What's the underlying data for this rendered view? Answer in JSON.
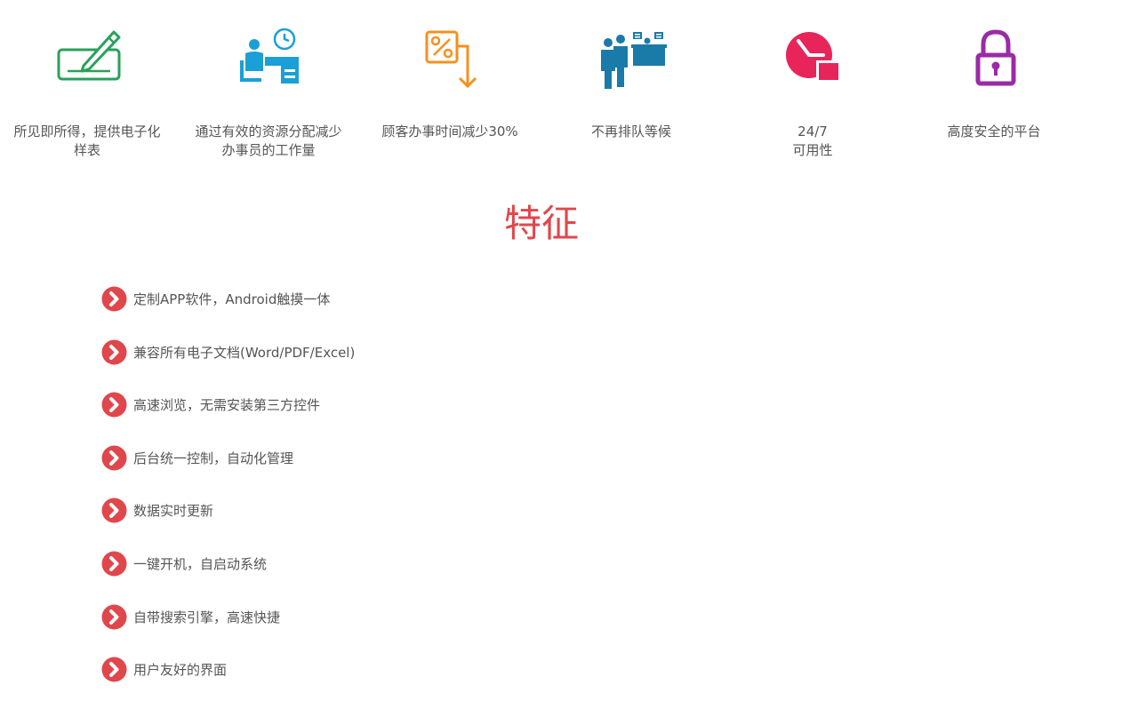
{
  "benefits": [
    {
      "icon": "form-pen-icon",
      "color": "#2aa05a",
      "caption": "所见即所得，提供电子化样表"
    },
    {
      "icon": "clerk-desk-clock-icon",
      "color": "#1a9fd6",
      "caption": "通过有效的资源分配减少办事员的工作量"
    },
    {
      "icon": "percent-arrow-down-icon",
      "color": "#f5901e",
      "caption": "顾客办事时间减少30%"
    },
    {
      "icon": "queue-people-icon",
      "color": "#1a7aa8",
      "caption": "不再排队等候"
    },
    {
      "icon": "clock-24-icon",
      "color": "#e8255a",
      "caption_line1": "24/7",
      "caption_line2": "可用性"
    },
    {
      "icon": "padlock-icon",
      "color": "#9b2aa6",
      "caption": "高度安全的平台"
    }
  ],
  "section": {
    "title": "特征",
    "accent": "#e0474c"
  },
  "features": [
    "定制APP软件，Android触摸一体",
    "兼容所有电子文档(Word/PDF/Excel)",
    "高速浏览，无需安装第三方控件",
    "后台统一控制，自动化管理",
    "数据实时更新",
    "一键开机，自启动系统",
    "自带搜索引擎，高速快捷",
    "用户友好的界面"
  ]
}
